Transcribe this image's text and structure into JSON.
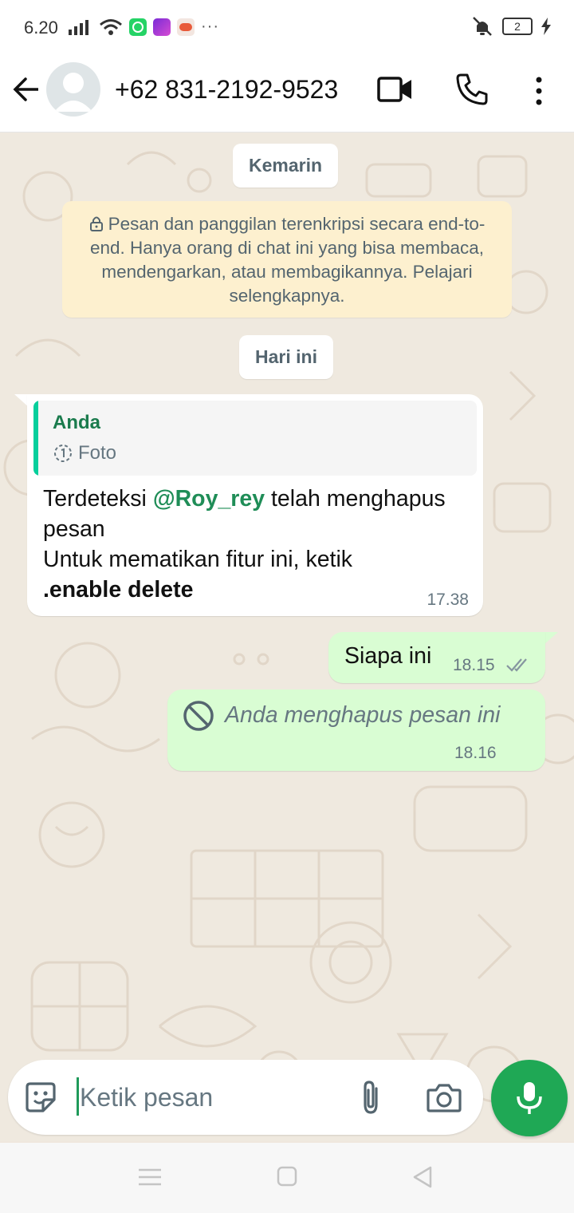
{
  "status_bar": {
    "time": "6.20",
    "battery_level": "2",
    "icons": [
      "signal-icon",
      "wifi-icon",
      "whatsapp-icon",
      "app-icon",
      "game-icon",
      "more-notifications-icon",
      "vibrate-icon",
      "battery-icon",
      "charging-icon"
    ],
    "more_label": "···"
  },
  "header": {
    "contact_name": "+62 831-2192-9523",
    "icons": [
      "back-arrow-icon",
      "avatar",
      "video-call-icon",
      "voice-call-icon",
      "more-options-icon"
    ]
  },
  "chat": {
    "date_yesterday": "Kemarin",
    "encryption_notice": "Pesan dan panggilan terenkripsi secara end-to-end. Hanya orang di chat ini yang bisa membaca, mendengarkan, atau membagikannya. Pelajari selengkapnya.",
    "date_today": "Hari ini",
    "incoming_message": {
      "quote_author": "Anda",
      "quote_type": "Foto",
      "text_part1": "Terdeteksi ",
      "mention": "@Roy_rey",
      "text_part2": " telah menghapus pesan",
      "text_line2": "Untuk mematikan fitur ini, ketik",
      "command": ".enable delete",
      "time": "17.38"
    },
    "outgoing_messages": [
      {
        "text": "Siapa ini",
        "time": "18.15",
        "status": "delivered-double-tick"
      },
      {
        "text": "Anda menghapus pesan ini",
        "time": "18.16",
        "status": "deleted"
      }
    ]
  },
  "composer": {
    "placeholder": "Ketik pesan",
    "icons": [
      "sticker-icon",
      "attach-icon",
      "camera-icon",
      "mic-icon"
    ]
  },
  "colors": {
    "accent": "#1fa855",
    "outgoing_bubble": "#d9fdd3",
    "encryption_notice_bg": "#fdf0cf",
    "mention": "#1f8d57",
    "wallpaper": "#efe9df"
  }
}
